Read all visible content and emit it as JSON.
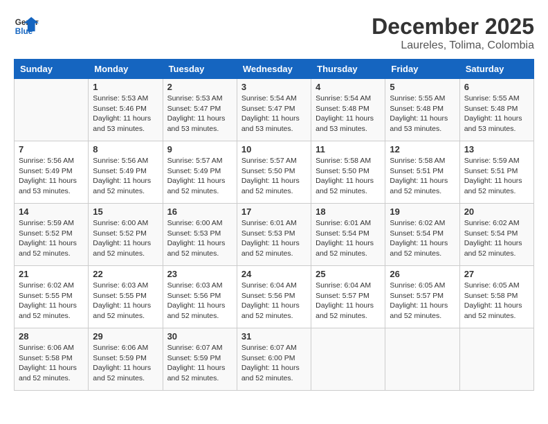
{
  "logo": {
    "general": "General",
    "blue": "Blue"
  },
  "title": {
    "month_year": "December 2025",
    "location": "Laureles, Tolima, Colombia"
  },
  "calendar": {
    "headers": [
      "Sunday",
      "Monday",
      "Tuesday",
      "Wednesday",
      "Thursday",
      "Friday",
      "Saturday"
    ],
    "weeks": [
      [
        {
          "day": "",
          "info": ""
        },
        {
          "day": "1",
          "info": "Sunrise: 5:53 AM\nSunset: 5:46 PM\nDaylight: 11 hours\nand 53 minutes."
        },
        {
          "day": "2",
          "info": "Sunrise: 5:53 AM\nSunset: 5:47 PM\nDaylight: 11 hours\nand 53 minutes."
        },
        {
          "day": "3",
          "info": "Sunrise: 5:54 AM\nSunset: 5:47 PM\nDaylight: 11 hours\nand 53 minutes."
        },
        {
          "day": "4",
          "info": "Sunrise: 5:54 AM\nSunset: 5:48 PM\nDaylight: 11 hours\nand 53 minutes."
        },
        {
          "day": "5",
          "info": "Sunrise: 5:55 AM\nSunset: 5:48 PM\nDaylight: 11 hours\nand 53 minutes."
        },
        {
          "day": "6",
          "info": "Sunrise: 5:55 AM\nSunset: 5:48 PM\nDaylight: 11 hours\nand 53 minutes."
        }
      ],
      [
        {
          "day": "7",
          "info": "Sunrise: 5:56 AM\nSunset: 5:49 PM\nDaylight: 11 hours\nand 53 minutes."
        },
        {
          "day": "8",
          "info": "Sunrise: 5:56 AM\nSunset: 5:49 PM\nDaylight: 11 hours\nand 52 minutes."
        },
        {
          "day": "9",
          "info": "Sunrise: 5:57 AM\nSunset: 5:49 PM\nDaylight: 11 hours\nand 52 minutes."
        },
        {
          "day": "10",
          "info": "Sunrise: 5:57 AM\nSunset: 5:50 PM\nDaylight: 11 hours\nand 52 minutes."
        },
        {
          "day": "11",
          "info": "Sunrise: 5:58 AM\nSunset: 5:50 PM\nDaylight: 11 hours\nand 52 minutes."
        },
        {
          "day": "12",
          "info": "Sunrise: 5:58 AM\nSunset: 5:51 PM\nDaylight: 11 hours\nand 52 minutes."
        },
        {
          "day": "13",
          "info": "Sunrise: 5:59 AM\nSunset: 5:51 PM\nDaylight: 11 hours\nand 52 minutes."
        }
      ],
      [
        {
          "day": "14",
          "info": "Sunrise: 5:59 AM\nSunset: 5:52 PM\nDaylight: 11 hours\nand 52 minutes."
        },
        {
          "day": "15",
          "info": "Sunrise: 6:00 AM\nSunset: 5:52 PM\nDaylight: 11 hours\nand 52 minutes."
        },
        {
          "day": "16",
          "info": "Sunrise: 6:00 AM\nSunset: 5:53 PM\nDaylight: 11 hours\nand 52 minutes."
        },
        {
          "day": "17",
          "info": "Sunrise: 6:01 AM\nSunset: 5:53 PM\nDaylight: 11 hours\nand 52 minutes."
        },
        {
          "day": "18",
          "info": "Sunrise: 6:01 AM\nSunset: 5:54 PM\nDaylight: 11 hours\nand 52 minutes."
        },
        {
          "day": "19",
          "info": "Sunrise: 6:02 AM\nSunset: 5:54 PM\nDaylight: 11 hours\nand 52 minutes."
        },
        {
          "day": "20",
          "info": "Sunrise: 6:02 AM\nSunset: 5:54 PM\nDaylight: 11 hours\nand 52 minutes."
        }
      ],
      [
        {
          "day": "21",
          "info": "Sunrise: 6:02 AM\nSunset: 5:55 PM\nDaylight: 11 hours\nand 52 minutes."
        },
        {
          "day": "22",
          "info": "Sunrise: 6:03 AM\nSunset: 5:55 PM\nDaylight: 11 hours\nand 52 minutes."
        },
        {
          "day": "23",
          "info": "Sunrise: 6:03 AM\nSunset: 5:56 PM\nDaylight: 11 hours\nand 52 minutes."
        },
        {
          "day": "24",
          "info": "Sunrise: 6:04 AM\nSunset: 5:56 PM\nDaylight: 11 hours\nand 52 minutes."
        },
        {
          "day": "25",
          "info": "Sunrise: 6:04 AM\nSunset: 5:57 PM\nDaylight: 11 hours\nand 52 minutes."
        },
        {
          "day": "26",
          "info": "Sunrise: 6:05 AM\nSunset: 5:57 PM\nDaylight: 11 hours\nand 52 minutes."
        },
        {
          "day": "27",
          "info": "Sunrise: 6:05 AM\nSunset: 5:58 PM\nDaylight: 11 hours\nand 52 minutes."
        }
      ],
      [
        {
          "day": "28",
          "info": "Sunrise: 6:06 AM\nSunset: 5:58 PM\nDaylight: 11 hours\nand 52 minutes."
        },
        {
          "day": "29",
          "info": "Sunrise: 6:06 AM\nSunset: 5:59 PM\nDaylight: 11 hours\nand 52 minutes."
        },
        {
          "day": "30",
          "info": "Sunrise: 6:07 AM\nSunset: 5:59 PM\nDaylight: 11 hours\nand 52 minutes."
        },
        {
          "day": "31",
          "info": "Sunrise: 6:07 AM\nSunset: 6:00 PM\nDaylight: 11 hours\nand 52 minutes."
        },
        {
          "day": "",
          "info": ""
        },
        {
          "day": "",
          "info": ""
        },
        {
          "day": "",
          "info": ""
        }
      ]
    ]
  }
}
